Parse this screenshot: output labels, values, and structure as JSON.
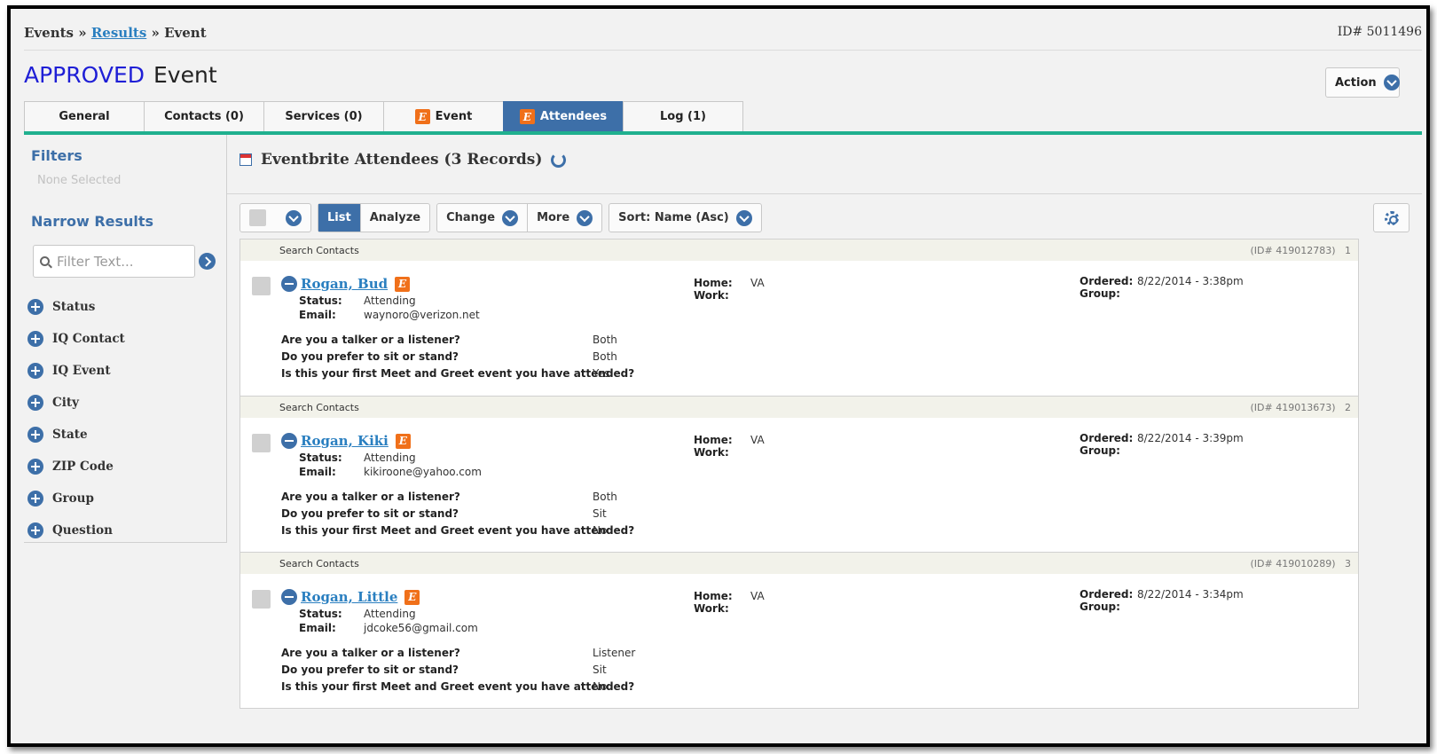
{
  "breadcrumb": {
    "events": "Events",
    "sep1": "»",
    "results": "Results",
    "sep2": "»",
    "current": "Event"
  },
  "record_id": "ID# 5011496",
  "title": {
    "status": "APPROVED",
    "text": "Event"
  },
  "action_label": "Action",
  "tabs": [
    {
      "label": "General",
      "eventbrite": false,
      "active": false
    },
    {
      "label": "Contacts (0)",
      "eventbrite": false,
      "active": false
    },
    {
      "label": "Services (0)",
      "eventbrite": false,
      "active": false
    },
    {
      "label": "Event",
      "eventbrite": true,
      "active": false
    },
    {
      "label": "Attendees",
      "eventbrite": true,
      "active": true
    },
    {
      "label": "Log (1)",
      "eventbrite": false,
      "active": false
    }
  ],
  "eventbrite_badge": "E",
  "sidebar": {
    "filters_heading": "Filters",
    "none_selected": "None Selected",
    "narrow_heading": "Narrow Results",
    "filter_placeholder": "Filter Text...",
    "facets": [
      "Status",
      "IQ Contact",
      "IQ Event",
      "City",
      "State",
      "ZIP Code",
      "Group",
      "Question"
    ]
  },
  "main": {
    "title": "Eventbrite Attendees (3 Records)",
    "toolbar": {
      "list": "List",
      "analyze": "Analyze",
      "change": "Change",
      "more": "More",
      "sort": "Sort: Name (Asc)"
    }
  },
  "labels": {
    "search_contacts": "Search Contacts",
    "status": "Status:",
    "email": "Email:",
    "home": "Home:",
    "work": "Work:",
    "ordered": "Ordered:",
    "group": "Group:",
    "q1": "Are you a talker or a listener?",
    "q2": "Do you prefer to sit or stand?",
    "q3": "Is this your first Meet and Greet event you have attended?"
  },
  "records": [
    {
      "id": "(ID# 419012783)",
      "index": "1",
      "name": "Rogan, Bud",
      "status": "Attending",
      "email": "waynoro@verizon.net",
      "home": "VA",
      "ordered": "8/22/2014 - 3:38pm",
      "a1": "Both",
      "a2": "Both",
      "a3": "Yes"
    },
    {
      "id": "(ID# 419013673)",
      "index": "2",
      "name": "Rogan, Kiki",
      "status": "Attending",
      "email": "kikiroone@yahoo.com",
      "home": "VA",
      "ordered": "8/22/2014 - 3:39pm",
      "a1": "Both",
      "a2": "Sit",
      "a3": "No"
    },
    {
      "id": "(ID# 419010289)",
      "index": "3",
      "name": "Rogan, Little",
      "status": "Attending",
      "email": "jdcoke56@gmail.com",
      "home": "VA",
      "ordered": "8/22/2014 - 3:34pm",
      "a1": "Listener",
      "a2": "Sit",
      "a3": "No"
    }
  ],
  "colors": {
    "accent": "#3d6fa8",
    "approved": "#1f1fd6",
    "tab_underline": "#20b08f",
    "eventbrite": "#f0701a",
    "link": "#2a7fc0"
  }
}
